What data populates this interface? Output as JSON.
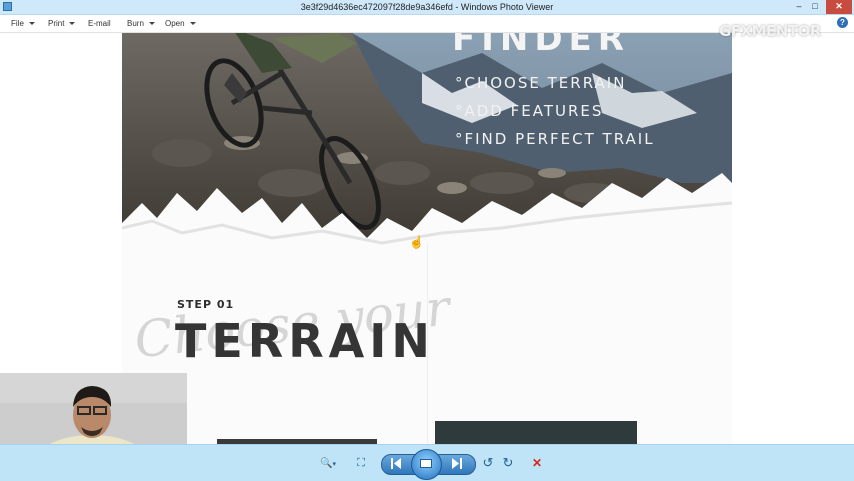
{
  "window": {
    "title": "3e3f29d4636ec472097f28de9a346efd - Windows Photo Viewer",
    "controls": {
      "minimize": "–",
      "maximize": "□",
      "close": "✕"
    }
  },
  "menu": {
    "items": [
      {
        "label": "File",
        "has_dropdown": true
      },
      {
        "label": "Print",
        "has_dropdown": true
      },
      {
        "label": "E-mail",
        "has_dropdown": false
      },
      {
        "label": "Burn",
        "has_dropdown": true
      },
      {
        "label": "Open",
        "has_dropdown": true
      }
    ],
    "help_icon": "?"
  },
  "photo": {
    "heading_partial": "FINDER",
    "features": [
      "CHOOSE TERRAIN",
      "ADD FEATURES",
      "FIND PERFECT TRAIL"
    ],
    "bullet": "°",
    "step_label": "STEP 01",
    "script_word": "Choose your",
    "section_title": "TERRAIN"
  },
  "watermark": {
    "logo": "GFXMENTOR"
  },
  "toolbar": {
    "zoom_icon": "🔍",
    "fit_icon": "⛶",
    "rotate_ccw": "↺",
    "rotate_cw": "↻",
    "delete_icon": "✕"
  },
  "colors": {
    "titlebar": "#cfe9fb",
    "toolbar": "#bfe3f7",
    "accent_blue": "#2f76bb",
    "delete_red": "#d42a1e",
    "close_button": "#c74b3f"
  }
}
